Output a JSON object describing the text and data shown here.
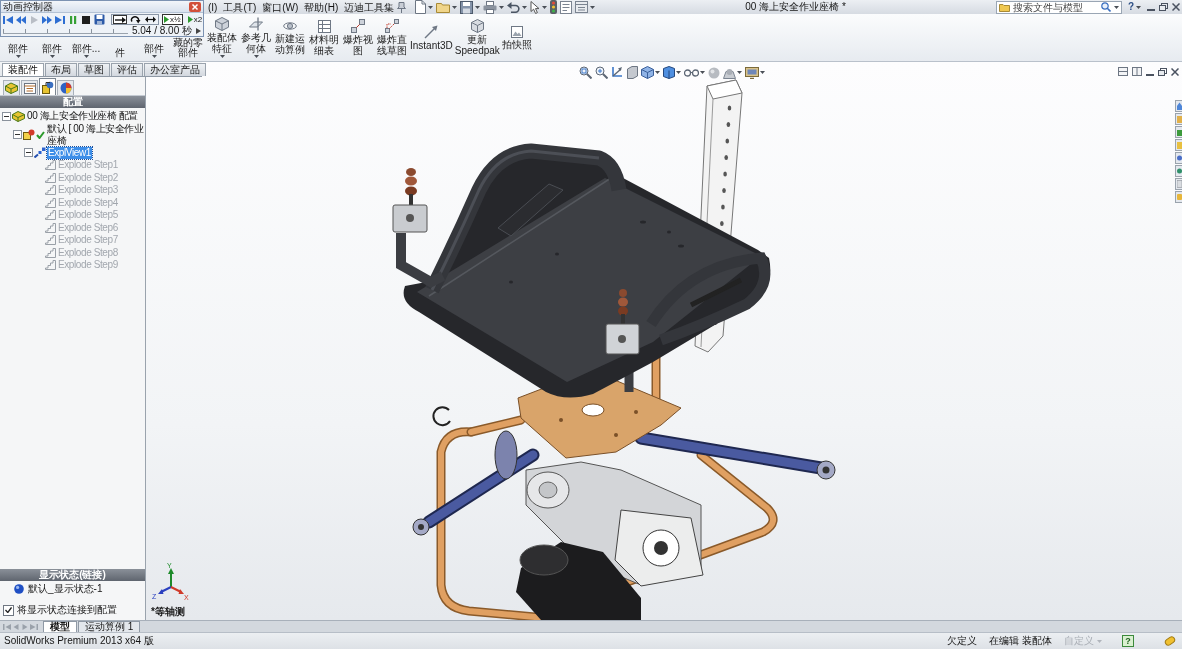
{
  "animation_controller": {
    "title": "动画控制器",
    "transport": [
      {
        "kind": "start",
        "disabled": false
      },
      {
        "kind": "rewind",
        "disabled": false
      },
      {
        "kind": "play",
        "disabled": true
      },
      {
        "kind": "forward",
        "disabled": false
      },
      {
        "kind": "end",
        "disabled": false
      },
      {
        "kind": "pause",
        "disabled": false
      },
      {
        "kind": "stop",
        "disabled": false
      },
      {
        "kind": "save",
        "disabled": false
      }
    ],
    "play_modes": [
      {
        "kind": "normal",
        "selected": true
      },
      {
        "kind": "loop",
        "selected": false
      },
      {
        "kind": "reciprocal",
        "selected": false
      }
    ],
    "speeds": [
      {
        "label": "x½",
        "selected": true
      },
      {
        "label": "x2",
        "selected": false
      }
    ],
    "time": "5.04 / 8.00 秒"
  },
  "menu_bar": {
    "menus": [
      "(I)",
      "工具(T)",
      "窗口(W)",
      "帮助(H)",
      "迈迪工具集"
    ],
    "toolbar": [
      {
        "kind": "new",
        "dropdown": true
      },
      {
        "kind": "open",
        "dropdown": true
      },
      {
        "kind": "save",
        "dropdown": true
      },
      {
        "kind": "print",
        "dropdown": true
      },
      {
        "kind": "undo",
        "dropdown": true
      },
      {
        "kind": "select",
        "dropdown": true
      },
      {
        "kind": "rebuild",
        "dropdown": false
      },
      {
        "kind": "file_properties",
        "dropdown": false
      },
      {
        "kind": "options",
        "dropdown": true
      }
    ],
    "title": "00 海上安全作业座椅 *",
    "search": {
      "placeholder": "搜索文件与模型"
    },
    "help": "?"
  },
  "ribbon": [
    {
      "kind": "covered",
      "label": "部件",
      "dropdown": true
    },
    {
      "kind": "covered",
      "label": "部件",
      "dropdown": true
    },
    {
      "kind": "covered",
      "label": "部件...",
      "dropdown": true
    },
    {
      "kind": "covered",
      "label": "件",
      "dropdown": false
    },
    {
      "kind": "covered",
      "label": "部件",
      "dropdown": true
    },
    {
      "kind": "covered",
      "label": "藏的零部件",
      "dropdown": false
    },
    {
      "kind": "assembly_features",
      "label": "装配体特征",
      "dropdown": true
    },
    {
      "kind": "reference_geometry",
      "label": "参考几何体",
      "dropdown": true
    },
    {
      "kind": "new_motion_study",
      "label": "新建运动算例",
      "dropdown": false
    },
    {
      "kind": "bom",
      "label": "材料明细表",
      "dropdown": false
    },
    {
      "kind": "exploded_view",
      "label": "爆炸视图",
      "dropdown": false
    },
    {
      "kind": "explode_line_sketch",
      "label": "爆炸直线草图",
      "dropdown": false
    },
    {
      "kind": "instant3d",
      "label": "Instant3D",
      "dropdown": false
    },
    {
      "kind": "speedpak",
      "label": "更新 Speedpak",
      "dropdown": false
    },
    {
      "kind": "snapshot",
      "label": "拍快照",
      "dropdown": false
    }
  ],
  "command_tabs": [
    {
      "label": "装配件",
      "selected": true
    },
    {
      "label": "布局",
      "selected": false
    },
    {
      "label": "草图",
      "selected": false
    },
    {
      "label": "评估",
      "selected": false
    },
    {
      "label": "办公室产品",
      "selected": false
    }
  ],
  "left_panel": {
    "manager_tabs": [
      {
        "kind": "feature_manager",
        "selected": false
      },
      {
        "kind": "property_manager",
        "selected": false
      },
      {
        "kind": "configuration_manager",
        "selected": true
      },
      {
        "kind": "display_manager",
        "selected": false
      }
    ],
    "header": "配置",
    "tree": [
      {
        "kind": "assembly",
        "label": "00 海上安全作业座椅 配置",
        "expanded": true,
        "selected": false,
        "children": [
          {
            "kind": "configuration",
            "label": "默认 [ 00 海上安全作业座椅",
            "expanded": true,
            "selected": false,
            "active": true,
            "children": [
              {
                "kind": "exploded_view",
                "label": "ExplView1",
                "expanded": true,
                "selected": true,
                "children": [
                  {
                    "kind": "step",
                    "label": "Explode Step1",
                    "selected": false,
                    "disabled": true
                  },
                  {
                    "kind": "step",
                    "label": "Explode Step2",
                    "selected": false,
                    "disabled": true
                  },
                  {
                    "kind": "step",
                    "label": "Explode Step3",
                    "selected": false,
                    "disabled": true
                  },
                  {
                    "kind": "step",
                    "label": "Explode Step4",
                    "selected": false,
                    "disabled": true
                  },
                  {
                    "kind": "step",
                    "label": "Explode Step5",
                    "selected": false,
                    "disabled": true
                  },
                  {
                    "kind": "step",
                    "label": "Explode Step6",
                    "selected": false,
                    "disabled": true
                  },
                  {
                    "kind": "step",
                    "label": "Explode Step7",
                    "selected": false,
                    "disabled": true
                  },
                  {
                    "kind": "step",
                    "label": "Explode Step8",
                    "selected": false,
                    "disabled": true
                  },
                  {
                    "kind": "step",
                    "label": "Explode Step9",
                    "selected": false,
                    "disabled": true
                  }
                ]
              }
            ]
          }
        ]
      }
    ],
    "display_states": {
      "header": "显示状态(链接)",
      "items": [
        {
          "label": "默认_显示状态-1"
        }
      ],
      "link_option": {
        "label": "将显示状态连接到配置",
        "checked": true
      }
    }
  },
  "viewport": {
    "toolbar": [
      {
        "kind": "zoom_fit",
        "dropdown": false
      },
      {
        "kind": "zoom_area",
        "dropdown": false
      },
      {
        "kind": "previous_view",
        "dropdown": false
      },
      {
        "kind": "section_view",
        "dropdown": false
      },
      {
        "kind": "view_orientation",
        "dropdown": true
      },
      {
        "kind": "display_style",
        "dropdown": true
      },
      {
        "kind": "hide_show",
        "dropdown": true
      },
      {
        "kind": "edit_appearance",
        "dropdown": false
      },
      {
        "kind": "apply_scene",
        "dropdown": true
      },
      {
        "kind": "view_settings",
        "dropdown": true
      }
    ],
    "task_pane": [
      {
        "kind": "resources"
      },
      {
        "kind": "design_library"
      },
      {
        "kind": "file_explorer"
      },
      {
        "kind": "view_palette"
      },
      {
        "kind": "appearances"
      },
      {
        "kind": "custom_properties"
      },
      {
        "kind": "documents"
      },
      {
        "kind": "forum"
      }
    ],
    "triad": {
      "y": "Y",
      "z": "Z",
      "x": "X"
    },
    "view_name": "*等轴测"
  },
  "bottom_tabs": [
    {
      "label": "模型",
      "selected": true
    },
    {
      "label": "运动算例 1",
      "selected": false
    }
  ],
  "status_bar": {
    "product": "SolidWorks Premium 2013 x64 版",
    "items": [
      {
        "label": "欠定义",
        "disabled": false,
        "dropdown": false
      },
      {
        "label": "在编辑 装配体",
        "disabled": false,
        "dropdown": false
      },
      {
        "label": "自定义",
        "disabled": true,
        "dropdown": true
      }
    ],
    "help": "?"
  }
}
